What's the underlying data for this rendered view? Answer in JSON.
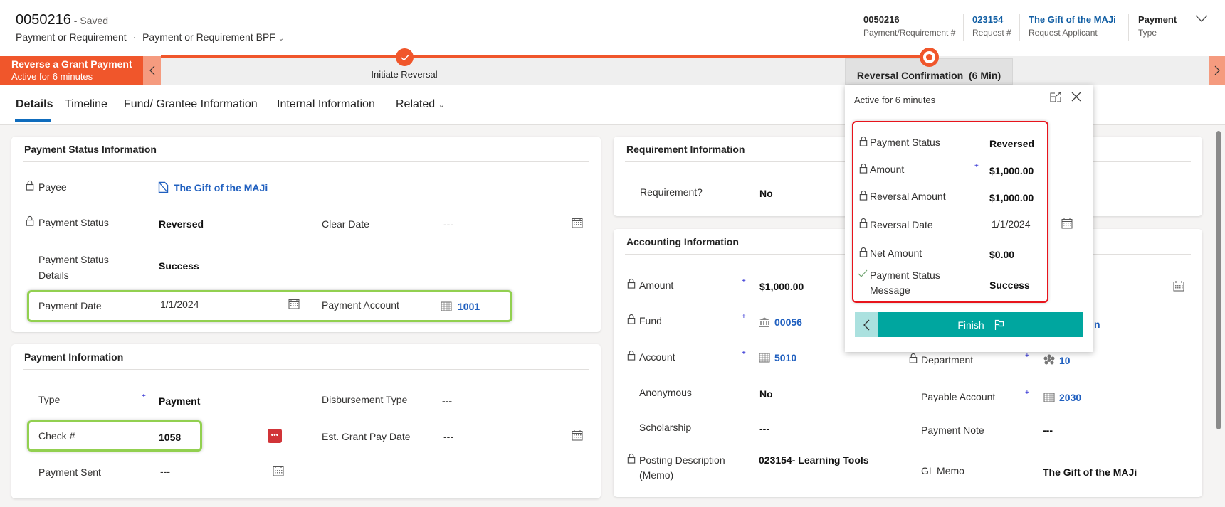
{
  "header": {
    "record_number": "0050216",
    "save_status": "- Saved",
    "entity": "Payment or Requirement",
    "separator": "·",
    "form": "Payment or Requirement BPF",
    "fields": [
      {
        "value": "0050216",
        "label": "Payment/Requirement #"
      },
      {
        "value": "023154",
        "label": "Request #"
      },
      {
        "value": "The Gift of the MAJi",
        "label": "Request Applicant"
      },
      {
        "value": "Payment",
        "label": "Type"
      }
    ]
  },
  "bpf": {
    "process_name": "Reverse a Grant Payment",
    "process_active": "Active for 6 minutes",
    "stages": [
      {
        "label": "Initiate Reversal",
        "status": "completed"
      },
      {
        "label": "Reversal Confirmation  (6 Min)",
        "status": "active"
      }
    ],
    "accent": "#f0562b"
  },
  "tabs": [
    {
      "label": "Details",
      "selected": true
    },
    {
      "label": "Timeline"
    },
    {
      "label": "Fund/ Grantee Information"
    },
    {
      "label": "Internal Information"
    },
    {
      "label": "Related"
    }
  ],
  "payment_status": {
    "title": "Payment Status Information",
    "payee_label": "Payee",
    "payee": "The Gift of the MAJi",
    "status_label": "Payment Status",
    "status": "Reversed",
    "clear_date_label": "Clear Date",
    "clear_date": "---",
    "details_label_1": "Payment Status",
    "details_label_2": "Details",
    "details": "Success",
    "payment_date_label": "Payment Date",
    "payment_date": "1/1/2024",
    "payment_account_label": "Payment Account",
    "payment_account": "1001"
  },
  "payment_info": {
    "title": "Payment Information",
    "type_label": "Type",
    "type": "Payment",
    "disb_label": "Disbursement Type",
    "disb": "---",
    "check_label": "Check #",
    "check": "1058",
    "est_label": "Est. Grant Pay Date",
    "est": "---",
    "sent_label": "Payment Sent",
    "sent": "---"
  },
  "requirement": {
    "title": "Requirement Information",
    "req_label": "Requirement?",
    "req": "No"
  },
  "accounting": {
    "title": "Accounting Information",
    "amount_label": "Amount",
    "amount": "$1,000.00",
    "fund_label": "Fund",
    "fund": "00056",
    "account_label": "Account",
    "account": "5010",
    "anon_label": "Anonymous",
    "anon": "No",
    "scholar_label": "Scholarship",
    "scholar": "---",
    "posting_label_1": "Posting Description",
    "posting_label_2": "(Memo)",
    "posting": "023154- Learning Tools",
    "dept_label": "Department",
    "dept": "10",
    "payable_label": "Payable Account",
    "payable": "2030",
    "note_label": "Payment Note",
    "note": "---",
    "gl_label": "GL Memo",
    "gl": "The Gift of the MAJi",
    "hidden_fragment": "n"
  },
  "flyout": {
    "active": "Active for 6 minutes",
    "rows": [
      {
        "label": "Payment Status",
        "value": "Reversed"
      },
      {
        "label": "Amount",
        "value": "$1,000.00"
      },
      {
        "label": "Reversal Amount",
        "value": "$1,000.00"
      },
      {
        "label": "Reversal Date",
        "value": "1/1/2024"
      },
      {
        "label": "Net Amount",
        "value": "$0.00"
      },
      {
        "label_1": "Payment Status",
        "label_2": "Message",
        "value": "Success"
      }
    ],
    "finish": "Finish",
    "finish_color": "#00a69f"
  }
}
